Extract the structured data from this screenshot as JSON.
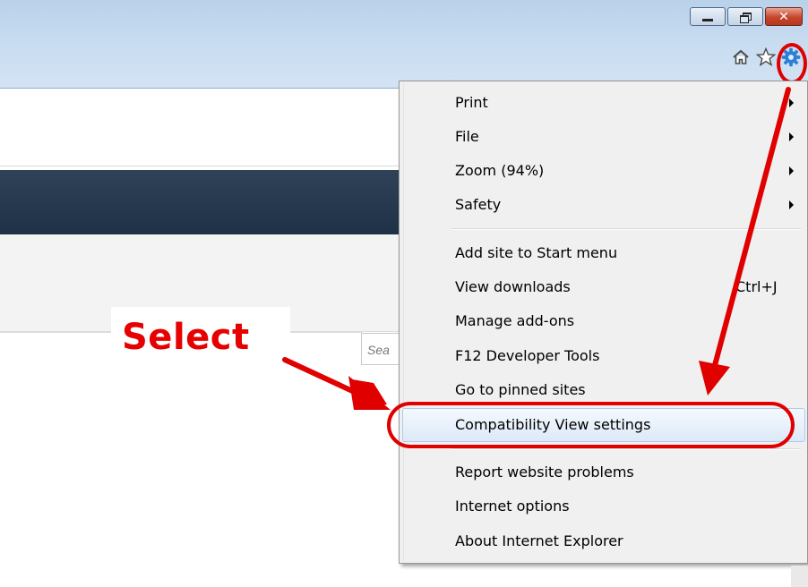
{
  "window": {
    "minimize_icon": "minimize-icon",
    "restore_icon": "restore-icon",
    "close_glyph": "✕"
  },
  "toolbar": {
    "icons": [
      "home-icon",
      "favorites-star-icon",
      "tools-gear-icon"
    ]
  },
  "page": {
    "search_placeholder": "Sea"
  },
  "annotation": {
    "select_label": "Select",
    "color": "#e60000"
  },
  "menu": {
    "items": [
      {
        "label": "Print",
        "submenu": true
      },
      {
        "label": "File",
        "submenu": true
      },
      {
        "label": "Zoom (94%)",
        "submenu": true
      },
      {
        "label": "Safety",
        "submenu": true
      },
      {
        "label": "Add site to Start menu"
      },
      {
        "label": "View downloads",
        "shortcut": "Ctrl+J"
      },
      {
        "label": "Manage add-ons"
      },
      {
        "label": "F12 Developer Tools"
      },
      {
        "label": "Go to pinned sites"
      },
      {
        "label": "Compatibility View settings",
        "highlighted": true
      },
      {
        "label": "Report website problems"
      },
      {
        "label": "Internet options"
      },
      {
        "label": "About Internet Explorer"
      }
    ]
  },
  "colors": {
    "titlebar": "#c7dbf0",
    "menu_bg": "#f0f0f0",
    "highlight": "#dde9f8",
    "annotation_red": "#e00000"
  }
}
